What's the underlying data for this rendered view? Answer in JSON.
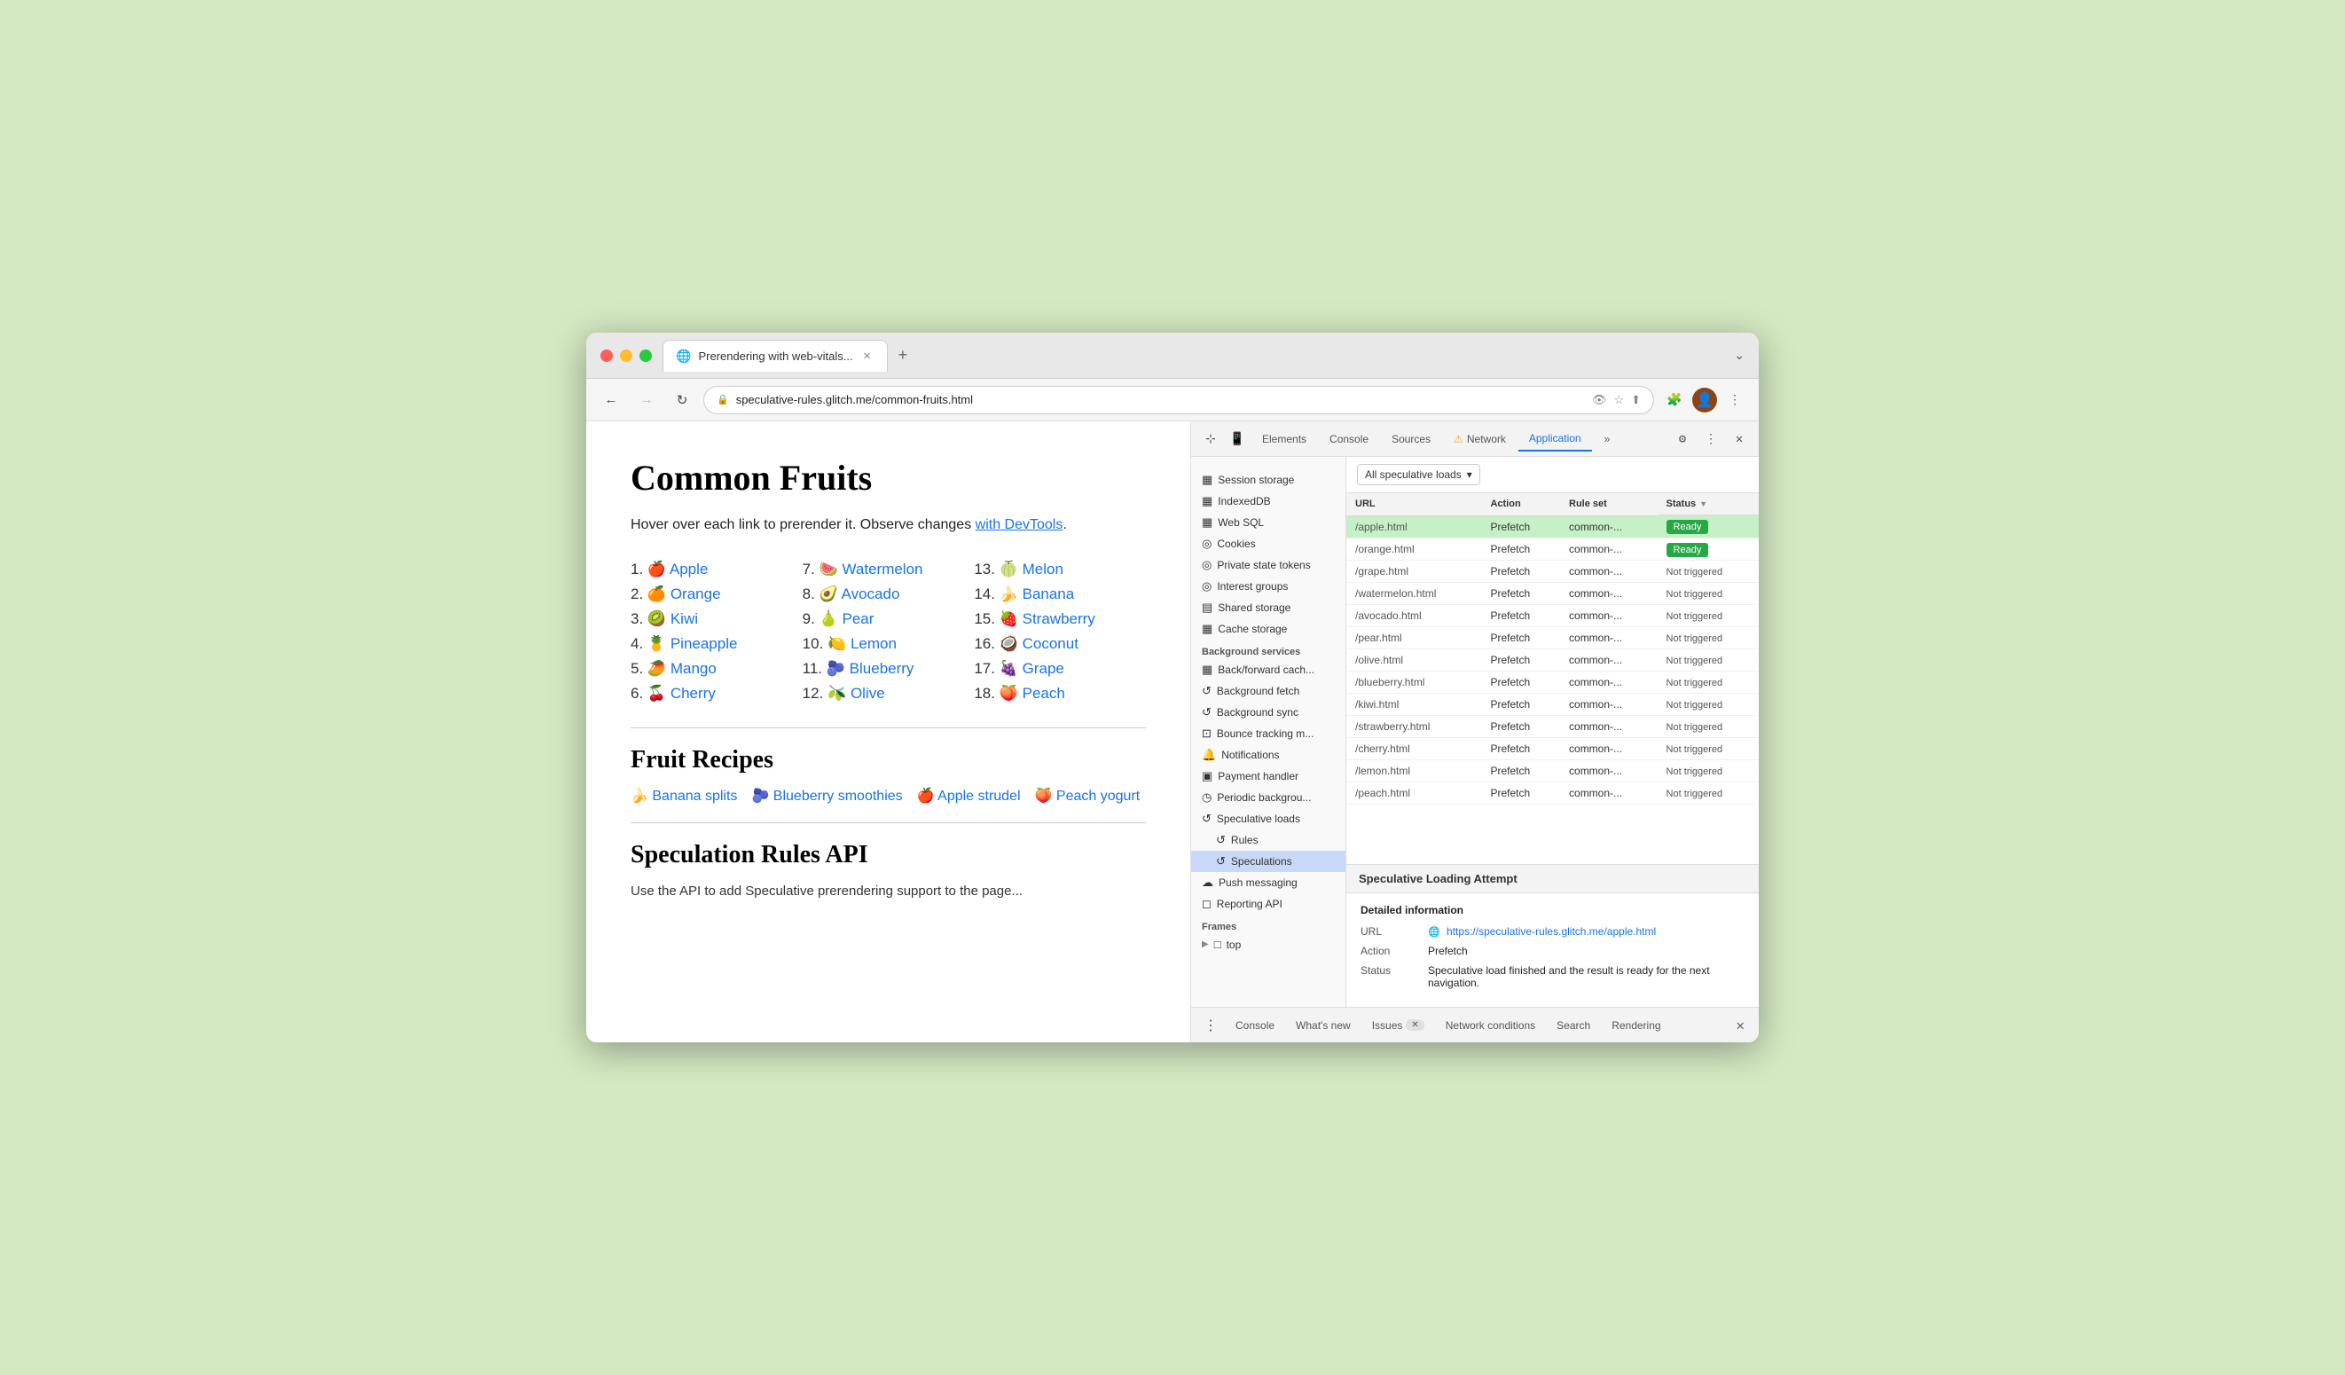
{
  "browser": {
    "tab_title": "Prerendering with web-vitals...",
    "tab_favicon": "🌐",
    "tab_close": "✕",
    "tab_add": "+",
    "dropdown_arrow": "⌄",
    "nav": {
      "back": "←",
      "forward": "→",
      "reload": "↻",
      "address": "speculative-rules.glitch.me/common-fruits.html",
      "address_icon": "🔒"
    }
  },
  "page": {
    "title": "Common Fruits",
    "intro_text": "Hover over each link to prerender it. Observe changes ",
    "intro_link1": "with DevTools",
    "intro_period": ".",
    "fruits": [
      {
        "num": "1.",
        "emoji": "🍎",
        "name": "Apple",
        "href": "/apple.html"
      },
      {
        "num": "2.",
        "emoji": "🍊",
        "name": "Orange",
        "href": "/orange.html"
      },
      {
        "num": "3.",
        "emoji": "🥝",
        "name": "Kiwi",
        "href": "/kiwi.html"
      },
      {
        "num": "4.",
        "emoji": "🍍",
        "name": "Pineapple",
        "href": "/pineapple.html"
      },
      {
        "num": "5.",
        "emoji": "🥭",
        "name": "Mango",
        "href": "/mango.html"
      },
      {
        "num": "6.",
        "emoji": "🍒",
        "name": "Cherry",
        "href": "/cherry.html"
      },
      {
        "num": "7.",
        "emoji": "🍉",
        "name": "Watermelon",
        "href": "/watermelon.html"
      },
      {
        "num": "8.",
        "emoji": "🥑",
        "name": "Avocado",
        "href": "/avocado.html"
      },
      {
        "num": "9.",
        "emoji": "🍐",
        "name": "Pear",
        "href": "/pear.html"
      },
      {
        "num": "10.",
        "emoji": "🍋",
        "name": "Lemon",
        "href": "/lemon.html"
      },
      {
        "num": "11.",
        "emoji": "🫐",
        "name": "Blueberry",
        "href": "/blueberry.html"
      },
      {
        "num": "12.",
        "emoji": "🫒",
        "name": "Olive",
        "href": "/olive.html"
      },
      {
        "num": "13.",
        "emoji": "🍈",
        "name": "Melon",
        "href": "/melon.html"
      },
      {
        "num": "14.",
        "emoji": "🍌",
        "name": "Banana",
        "href": "/banana.html"
      },
      {
        "num": "15.",
        "emoji": "🍓",
        "name": "Strawberry",
        "href": "/strawberry.html"
      },
      {
        "num": "16.",
        "emoji": "🥥",
        "name": "Coconut",
        "href": "/coconut.html"
      },
      {
        "num": "17.",
        "emoji": "🍇",
        "name": "Grape",
        "href": "/grape.html"
      },
      {
        "num": "18.",
        "emoji": "🍑",
        "name": "Peach",
        "href": "/peach.html"
      }
    ],
    "recipes_title": "Fruit Recipes",
    "recipes": [
      {
        "emoji": "🍌",
        "name": "Banana splits"
      },
      {
        "emoji": "🫐",
        "name": "Blueberry smoothies"
      },
      {
        "emoji": "🍎",
        "name": "Apple strudel"
      },
      {
        "emoji": "🍑",
        "name": "Peach yogurt"
      }
    ],
    "api_title": "Speculation Rules API"
  },
  "devtools": {
    "panel_tabs": [
      "Elements",
      "Console",
      "Sources",
      "Network",
      "Application"
    ],
    "active_tab": "Application",
    "network_warning": true,
    "settings_icon": "⚙",
    "more_icon": "⋮",
    "close_icon": "✕",
    "sidebar": {
      "storage_items": [
        {
          "icon": "▦",
          "label": "Session storage",
          "has_arrow": true
        },
        {
          "icon": "▦",
          "label": "IndexedDB"
        },
        {
          "icon": "▦",
          "label": "Web SQL"
        },
        {
          "icon": "◎",
          "label": "Cookies"
        },
        {
          "icon": "◎",
          "label": "Private state tokens"
        },
        {
          "icon": "◎",
          "label": "Interest groups"
        },
        {
          "icon": "▤",
          "label": "Shared storage",
          "has_arrow": true
        },
        {
          "icon": "▦",
          "label": "Cache storage"
        }
      ],
      "background_services": {
        "header": "Background services",
        "items": [
          {
            "icon": "▦",
            "label": "Back/forward cach..."
          },
          {
            "icon": "↺",
            "label": "Background fetch"
          },
          {
            "icon": "↺",
            "label": "Background sync"
          },
          {
            "icon": "⊡",
            "label": "Bounce tracking m..."
          },
          {
            "icon": "🔔",
            "label": "Notifications"
          },
          {
            "icon": "▣",
            "label": "Payment handler"
          },
          {
            "icon": "◷",
            "label": "Periodic backgrou..."
          },
          {
            "icon": "↺",
            "label": "Speculative loads",
            "has_arrow": true,
            "expanded": true
          },
          {
            "icon": "↺",
            "label": "Rules",
            "indent": true
          },
          {
            "icon": "↺",
            "label": "Speculations",
            "indent": true,
            "active": true
          },
          {
            "icon": "☁",
            "label": "Push messaging"
          },
          {
            "icon": "◻",
            "label": "Reporting API"
          }
        ]
      },
      "frames": {
        "header": "Frames",
        "items": [
          {
            "icon": "□",
            "label": "top",
            "has_arrow": true
          }
        ]
      }
    },
    "speculative_loads": {
      "filter_label": "All speculative loads",
      "columns": [
        "URL",
        "Action",
        "Rule set",
        "Status"
      ],
      "rows": [
        {
          "url": "/apple.html",
          "action": "Prefetch",
          "ruleset": "common-...",
          "status": "Ready",
          "highlighted": true
        },
        {
          "url": "/orange.html",
          "action": "Prefetch",
          "ruleset": "common-...",
          "status": "Ready"
        },
        {
          "url": "/grape.html",
          "action": "Prefetch",
          "ruleset": "common-...",
          "status": "Not triggered"
        },
        {
          "url": "/watermelon.html",
          "action": "Prefetch",
          "ruleset": "common-...",
          "status": "Not triggered"
        },
        {
          "url": "/avocado.html",
          "action": "Prefetch",
          "ruleset": "common-...",
          "status": "Not triggered"
        },
        {
          "url": "/pear.html",
          "action": "Prefetch",
          "ruleset": "common-...",
          "status": "Not triggered"
        },
        {
          "url": "/olive.html",
          "action": "Prefetch",
          "ruleset": "common-...",
          "status": "Not triggered"
        },
        {
          "url": "/blueberry.html",
          "action": "Prefetch",
          "ruleset": "common-...",
          "status": "Not triggered"
        },
        {
          "url": "/kiwi.html",
          "action": "Prefetch",
          "ruleset": "common-...",
          "status": "Not triggered"
        },
        {
          "url": "/strawberry.html",
          "action": "Prefetch",
          "ruleset": "common-...",
          "status": "Not triggered"
        },
        {
          "url": "/cherry.html",
          "action": "Prefetch",
          "ruleset": "common-...",
          "status": "Not triggered"
        },
        {
          "url": "/lemon.html",
          "action": "Prefetch",
          "ruleset": "common-...",
          "status": "Not triggered"
        },
        {
          "url": "/peach.html",
          "action": "Prefetch",
          "ruleset": "common-...",
          "status": "Not triggered"
        }
      ]
    },
    "sla_panel": {
      "title": "Speculative Loading Attempt",
      "detailed_info_title": "Detailed information",
      "url_label": "URL",
      "url_value": "https://speculative-rules.glitch.me/apple.html",
      "action_label": "Action",
      "action_value": "Prefetch",
      "status_label": "Status",
      "status_value": "Speculative load finished and the result is ready for the next navigation."
    },
    "bottom_tabs": [
      "Console",
      "What's new",
      "Issues",
      "Network conditions",
      "Search",
      "Rendering"
    ],
    "issues_count": "×"
  }
}
